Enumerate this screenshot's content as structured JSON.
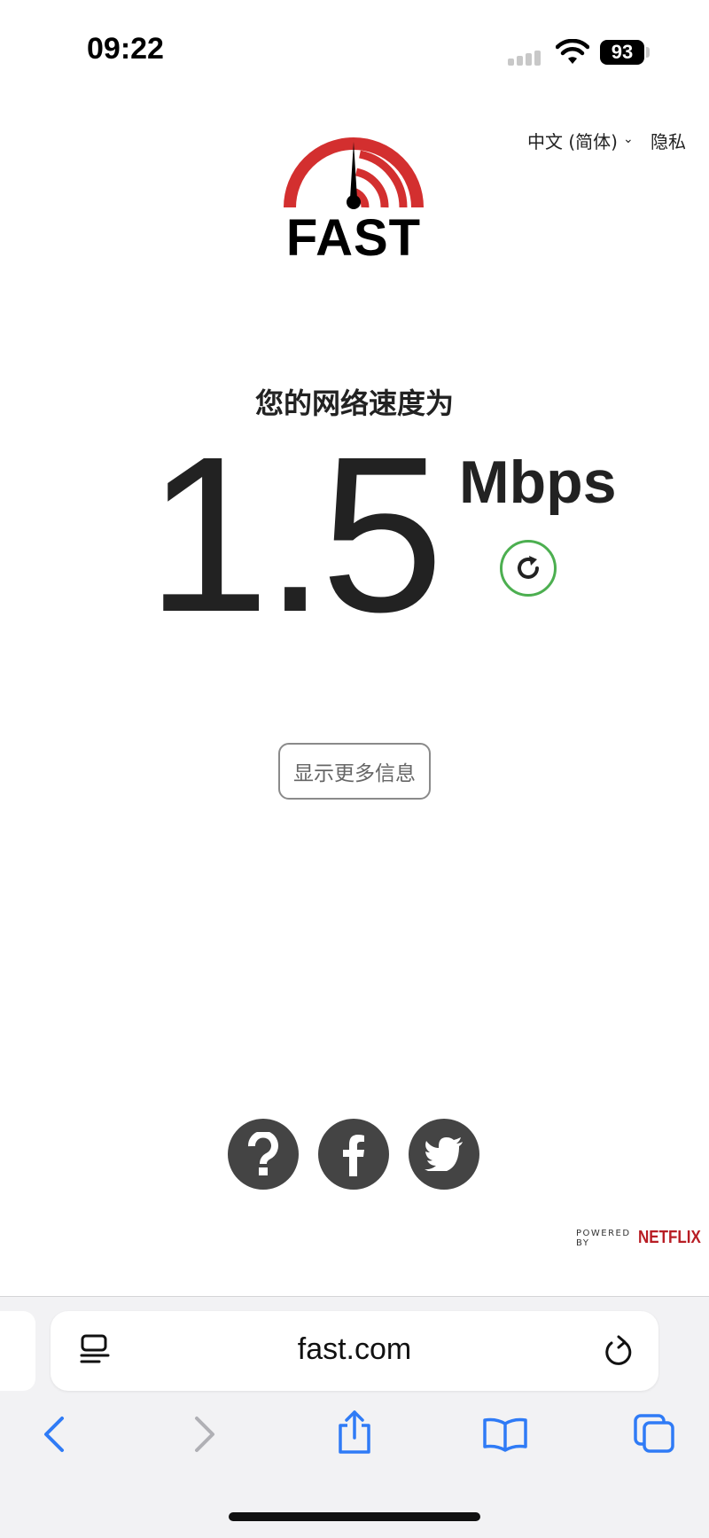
{
  "status_bar": {
    "time": "09:22",
    "battery": "93"
  },
  "header": {
    "language": "中文 (简体)",
    "privacy": "隐私"
  },
  "logo": {
    "text": "FAST"
  },
  "speed": {
    "label": "您的网络速度为",
    "value": "1.5",
    "unit": "Mbps"
  },
  "more_info_label": "显示更多信息",
  "footer": {
    "powered_by": "POWERED BY",
    "brand": "NETFLIX"
  },
  "browser": {
    "url": "fast.com"
  },
  "colors": {
    "accent_red": "#d32f2f",
    "refresh_green": "#4caf50",
    "social_bg": "#444444",
    "safari_blue": "#2f7bf6",
    "netflix_red": "#b81d24"
  }
}
